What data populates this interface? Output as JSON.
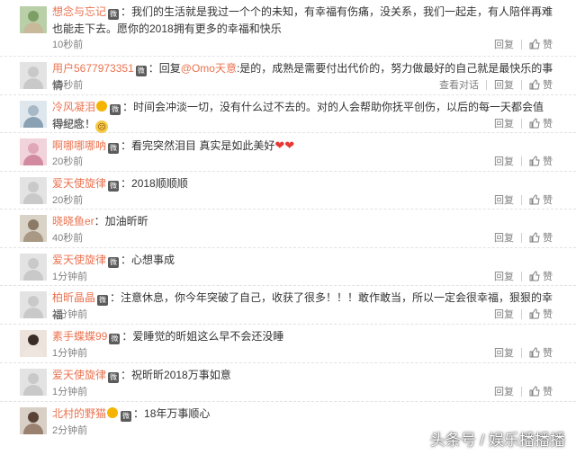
{
  "actions": {
    "view_thread": "查看对话",
    "reply": "回复",
    "like": "赞"
  },
  "vip_badge": "微",
  "comments": [
    {
      "user": "想念与忘记",
      "text": "：我们的生活就是我过一个个的未知，有幸福有伤痛，没关系，我们一起走，有人陪伴再难也能走下去。愿你的2018拥有更多的幸福和快乐",
      "time": "10秒前"
    },
    {
      "user": "用户5677973351",
      "reply_prefix": "：回复",
      "mention": "@Omo天意",
      "text": ":是的，成熟是需要付出代价的，努力做最好的自己就是最快乐的事情",
      "time": "10秒前"
    },
    {
      "user": "冷风凝泪",
      "text": "：时间会冲淡一切，没有什么过不去的。对的人会帮助你抚平创伤，以后的每一天都会值得纪念！",
      "time": "10秒前"
    },
    {
      "user": "啊哪哪哪呐",
      "text": "：看完突然泪目 真实是如此美好",
      "time": "20秒前"
    },
    {
      "user": "爱天使旋律",
      "text": "：2018顺顺顺",
      "time": "20秒前"
    },
    {
      "user": "晓晓鱼er",
      "text": "：加油昕昕",
      "time": "40秒前"
    },
    {
      "user": "爱天使旋律",
      "text": "：心想事成",
      "time": "1分钟前"
    },
    {
      "user": "柏昕晶晶",
      "text": "：注意休息，你今年突破了自己，收获了很多！！！敢作敢当，所以一定会很幸福，狠狠的幸福",
      "time": "1分钟前"
    },
    {
      "user": "素手蝶蝶99",
      "text": "：爱睡觉的昕姐这么早不会还没睡",
      "time": "1分钟前"
    },
    {
      "user": "爱天使旋律",
      "text": "：祝昕昕2018万事如意",
      "time": "1分钟前"
    },
    {
      "user": "北村的野猫",
      "text": "：18年万事顺心",
      "time": "2分钟前"
    }
  ],
  "watermark": "头条号 / 娱乐播播播",
  "colors": {
    "username": "#eb7350",
    "meta": "#808080",
    "text": "#333333"
  }
}
